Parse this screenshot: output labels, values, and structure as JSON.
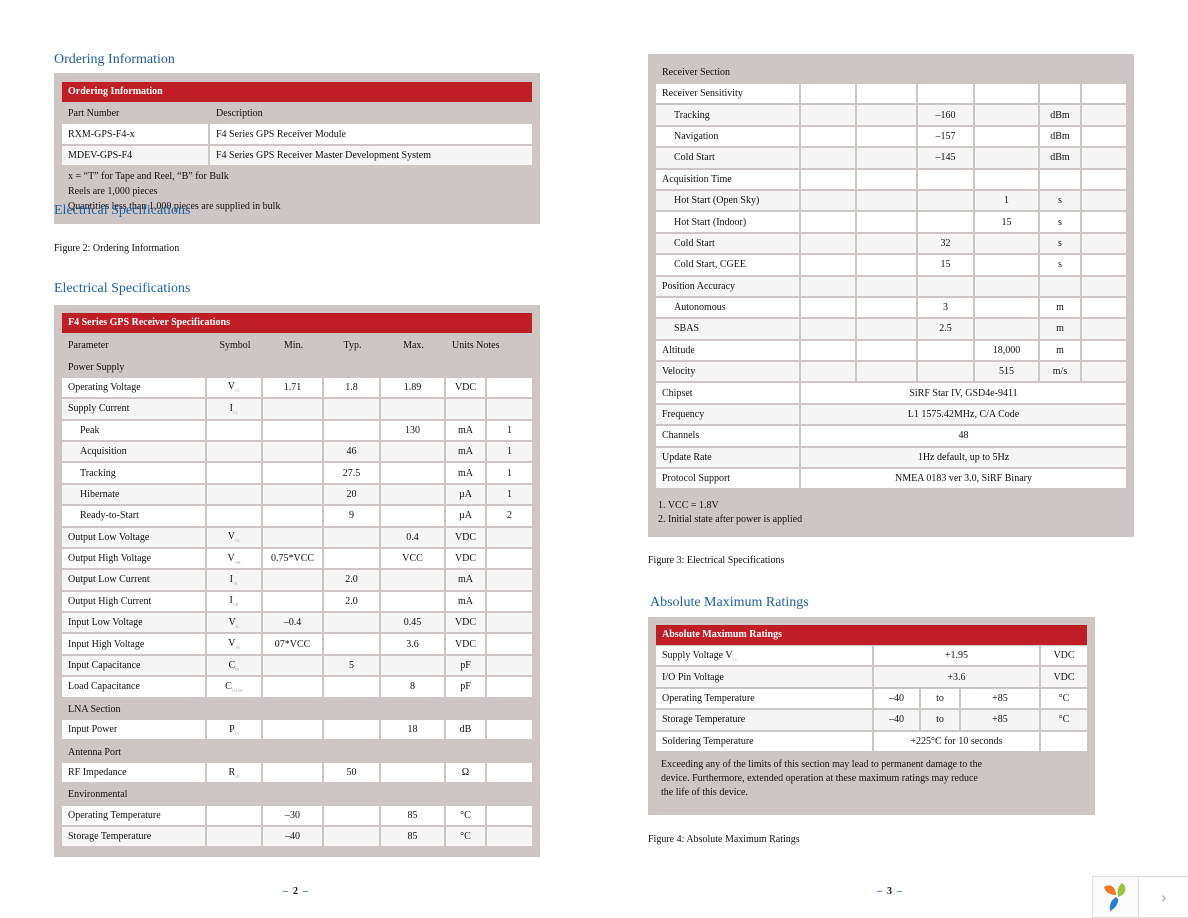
{
  "left_page": {
    "ordering": {
      "heading": "Ordering Information",
      "table_title": "Ordering Information",
      "columns": [
        "Part Number",
        "Description"
      ],
      "rows": [
        [
          "RXM-GPS-F4-x",
          "F4 Series GPS Receiver Module"
        ],
        [
          "MDEV-GPS-F4",
          "F4 Series GPS Receiver Master Development System"
        ]
      ],
      "notes": [
        "x = “T” for Tape and Reel, “B” for Bulk",
        "Reels are 1,000 pieces",
        "Quantities less than 1,000 pieces are supplied in bulk"
      ],
      "overlap_heading": "Electrical Specifications",
      "caption": "Figure 2: Ordering Information"
    },
    "electrical": {
      "heading": "Electrical Specifications",
      "table_title": "F4 Series GPS Receiver Specifications",
      "columns": [
        "Parameter",
        "Symbol",
        "Min.",
        "Typ.",
        "Max.",
        "Units Notes"
      ],
      "rows": [
        {
          "type": "sec",
          "cells": [
            "Power Supply"
          ]
        },
        {
          "type": "w",
          "cells": [
            "Operating Voltage",
            "V",
            "1.71",
            "1.8",
            "1.89",
            "VDC",
            ""
          ],
          "sub": "CC"
        },
        {
          "type": "g",
          "cells": [
            "Supply Current",
            "I",
            "",
            "",
            "",
            "",
            ""
          ],
          "sub": "CC"
        },
        {
          "type": "w",
          "indent": true,
          "cells": [
            "Peak",
            "",
            "",
            "",
            "130",
            "mA",
            "1"
          ]
        },
        {
          "type": "g",
          "indent": true,
          "cells": [
            "Acquisition",
            "",
            "",
            "46",
            "",
            "mA",
            "1"
          ]
        },
        {
          "type": "w",
          "indent": true,
          "cells": [
            "Tracking",
            "",
            "",
            "27.5",
            "",
            "mA",
            "1"
          ]
        },
        {
          "type": "g",
          "indent": true,
          "cells": [
            "Hibernate",
            "",
            "",
            "20",
            "",
            "µA",
            "1"
          ]
        },
        {
          "type": "w",
          "indent": true,
          "cells": [
            "Ready-to-Start",
            "",
            "",
            "9",
            "",
            "µA",
            "2"
          ]
        },
        {
          "type": "g",
          "cells": [
            "Output Low Voltage",
            "V",
            "",
            "",
            "0.4",
            "VDC",
            ""
          ],
          "sub": "OL"
        },
        {
          "type": "w",
          "cells": [
            "Output High Voltage",
            "V",
            "0.75*VCC",
            "",
            "VCC",
            "VDC",
            ""
          ],
          "sub": "OH"
        },
        {
          "type": "g",
          "cells": [
            "Output Low Current",
            "I",
            "",
            "2.0",
            "",
            "mA",
            ""
          ],
          "sub": "OL"
        },
        {
          "type": "w",
          "cells": [
            "Output High Current",
            "I",
            "",
            "2.0",
            "",
            "mA",
            ""
          ],
          "sub": "OH"
        },
        {
          "type": "g",
          "cells": [
            "Input Low Voltage",
            "V",
            "–0.4",
            "",
            "0.45",
            "VDC",
            ""
          ],
          "sub": "IL"
        },
        {
          "type": "w",
          "cells": [
            "Input High Voltage",
            "V",
            "07*VCC",
            "",
            "3.6",
            "VDC",
            ""
          ],
          "sub": "IH"
        },
        {
          "type": "g",
          "cells": [
            "Input Capacitance",
            "C",
            "",
            "5",
            "",
            "pF",
            ""
          ],
          "sub": "IN"
        },
        {
          "type": "w",
          "cells": [
            "Load Capacitance",
            "C",
            "",
            "",
            "8",
            "pF",
            ""
          ],
          "sub": "LOAD"
        },
        {
          "type": "sec",
          "cells": [
            "LNA Section"
          ]
        },
        {
          "type": "w",
          "cells": [
            "Input Power",
            "P",
            "",
            "",
            "18",
            "dB",
            ""
          ],
          "sub": "IN"
        },
        {
          "type": "sec",
          "cells": [
            "Antenna Port"
          ]
        },
        {
          "type": "w",
          "cells": [
            "RF Impedance",
            "R",
            "",
            "50",
            "",
            "Ω",
            ""
          ],
          "sub": "IN"
        },
        {
          "type": "sec",
          "cells": [
            "Environmental"
          ]
        },
        {
          "type": "w",
          "cells": [
            "Operating Temperature",
            "",
            "–30",
            "",
            "85",
            "°C",
            ""
          ]
        },
        {
          "type": "g",
          "cells": [
            "Storage Temperature",
            "",
            "–40",
            "",
            "85",
            "°C",
            ""
          ]
        }
      ]
    },
    "page_number": "2"
  },
  "right_page": {
    "receiver": {
      "section_label": "Receiver Section",
      "rows": [
        {
          "type": "w",
          "cells": [
            "Receiver Sensitivity",
            "",
            "",
            "",
            "",
            "",
            ""
          ]
        },
        {
          "type": "g",
          "indent": true,
          "cells": [
            "Tracking",
            "",
            "",
            "–160",
            "",
            "dBm",
            ""
          ]
        },
        {
          "type": "w",
          "indent": true,
          "cells": [
            "Navigation",
            "",
            "",
            "–157",
            "",
            "dBm",
            ""
          ]
        },
        {
          "type": "g",
          "indent": true,
          "cells": [
            "Cold Start",
            "",
            "",
            "–145",
            "",
            "dBm",
            ""
          ]
        },
        {
          "type": "w",
          "cells": [
            "Acquisition Time",
            "",
            "",
            "",
            "",
            "",
            ""
          ]
        },
        {
          "type": "g",
          "indent": true,
          "cells": [
            "Hot Start (Open Sky)",
            "",
            "",
            "",
            "1",
            "s",
            ""
          ]
        },
        {
          "type": "w",
          "indent": true,
          "cells": [
            "Hot Start (Indoor)",
            "",
            "",
            "",
            "15",
            "s",
            ""
          ]
        },
        {
          "type": "g",
          "indent": true,
          "cells": [
            "Cold Start",
            "",
            "",
            "32",
            "",
            "s",
            ""
          ]
        },
        {
          "type": "w",
          "indent": true,
          "cells": [
            "Cold Start, CGEE",
            "",
            "",
            "15",
            "",
            "s",
            ""
          ]
        },
        {
          "type": "g",
          "cells": [
            "Position Accuracy",
            "",
            "",
            "",
            "",
            "",
            ""
          ]
        },
        {
          "type": "w",
          "indent": true,
          "cells": [
            "Autonomous",
            "",
            "",
            "3",
            "",
            "m",
            ""
          ]
        },
        {
          "type": "g",
          "indent": true,
          "cells": [
            "SBAS",
            "",
            "",
            "2.5",
            "",
            "m",
            ""
          ]
        },
        {
          "type": "w",
          "cells": [
            "Altitude",
            "",
            "",
            "",
            "18,000",
            "m",
            ""
          ]
        },
        {
          "type": "g",
          "cells": [
            "Velocity",
            "",
            "",
            "",
            "515",
            "m/s",
            ""
          ]
        }
      ],
      "merged_rows": [
        {
          "type": "w",
          "label": "Chipset",
          "value": "SiRF Star IV, GSD4e-9411"
        },
        {
          "type": "g",
          "label": "Frequency",
          "value": "L1 1575.42MHz, C/A Code"
        },
        {
          "type": "w",
          "label": "Channels",
          "value": "48"
        },
        {
          "type": "g",
          "label": "Update Rate",
          "value": "1Hz default, up to 5Hz"
        },
        {
          "type": "w",
          "label": "Protocol Support",
          "value": "NMEA 0183 ver 3.0, SiRF Binary"
        }
      ],
      "footnotes": [
        "1.  VCC = 1.8V",
        "2.  Initial state after power is applied"
      ],
      "caption": "Figure 3: Electrical Specifications"
    },
    "absmax": {
      "heading": "Absolute Maximum Ratings",
      "table_title": "Absolute Maximum Ratings",
      "rows": [
        {
          "type": "w",
          "label": "Supply Voltage V",
          "sub": "CC",
          "value": "+1.95",
          "unit": "VDC"
        },
        {
          "type": "g",
          "label": "I/O Pin Voltage",
          "value": "+3.6",
          "unit": "VDC"
        },
        {
          "type": "w",
          "label": "Operating Temperature",
          "min": "–40",
          "to": "to",
          "max": "+85",
          "unit": "°C"
        },
        {
          "type": "g",
          "label": "Storage Temperature",
          "min": "–40",
          "to": "to",
          "max": "+85",
          "unit": "°C"
        },
        {
          "type": "w",
          "label": "Soldering Temperature",
          "value": "+225°C for 10 seconds",
          "unit": ""
        }
      ],
      "warning": "Exceeding any of the limits of this section may lead to permanent damage to the device. Furthermore, extended operation at these maximum ratings may reduce the life of this device.",
      "caption": "Figure 4: Absolute Maximum Ratings"
    },
    "page_number": "3"
  },
  "viewer_nav": {
    "logo_icon": "app-logo-icon",
    "next_label": "›"
  }
}
